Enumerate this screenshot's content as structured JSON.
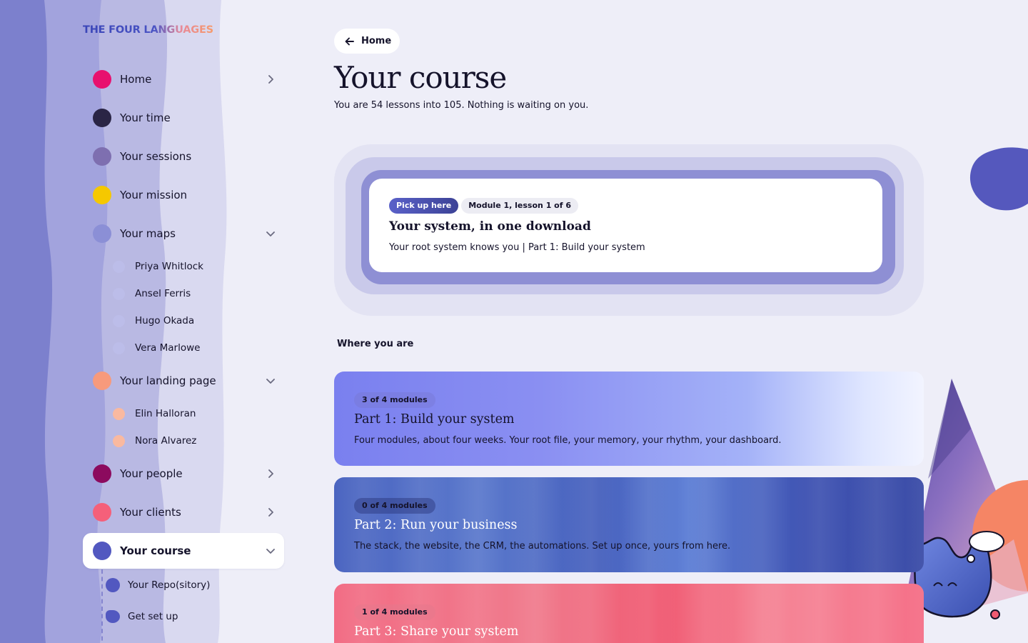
{
  "brand": {
    "logo_text": "THE FOUR LANGUAGES"
  },
  "sidebar": {
    "items": [
      {
        "label": "Home",
        "color": "#e8106e",
        "chevron": "right"
      },
      {
        "label": "Your time",
        "color": "#2a2545",
        "chevron": ""
      },
      {
        "label": "Your sessions",
        "color": "#7e6fb0",
        "chevron": ""
      },
      {
        "label": "Your mission",
        "color": "#f5c800",
        "chevron": ""
      },
      {
        "label": "Your maps",
        "color": "#8b8fd6",
        "chevron": "down"
      },
      {
        "label": "Your landing page",
        "color": "#f79a7c",
        "chevron": "down"
      },
      {
        "label": "Your people",
        "color": "#8c0a5e",
        "chevron": "right"
      },
      {
        "label": "Your clients",
        "color": "#f5607a",
        "chevron": "right"
      },
      {
        "label": "Your course",
        "color": "#5258c0",
        "chevron": "down",
        "active": true
      }
    ],
    "maps_children": [
      "Priya Whitlock",
      "Ansel Ferris",
      "Hugo Okada",
      "Vera Marlowe"
    ],
    "landing_children": [
      "Elin Halloran",
      "Nora Alvarez"
    ],
    "course_children": [
      "Your Repo(sitory)",
      "Get set up"
    ]
  },
  "main": {
    "back_button": "Home",
    "title": "Your course",
    "subtitle": "You are 54 lessons into 105. Nothing is waiting on you.",
    "resume": {
      "badge": "Pick up here",
      "position": "Module 1, lesson 1 of 6",
      "title": "Your system, in one download",
      "meta": "Your root system knows you | Part 1: Build your system"
    },
    "section_label": "Where you are",
    "parts": [
      {
        "progress": "3 of 4 modules",
        "title": "Part 1: Build your system",
        "desc": "Four modules, about four weeks. Your root file, your memory, your rhythm, your dashboard."
      },
      {
        "progress": "0 of 4 modules",
        "title": "Part 2: Run your business",
        "desc": "The stack, the website, the CRM, the automations. Set up once, yours from here."
      },
      {
        "progress": "1 of 4 modules",
        "title": "Part 3: Share your system",
        "desc": ""
      }
    ]
  },
  "colors": {
    "accent": "#5258c0",
    "background": "#eeeef8"
  }
}
